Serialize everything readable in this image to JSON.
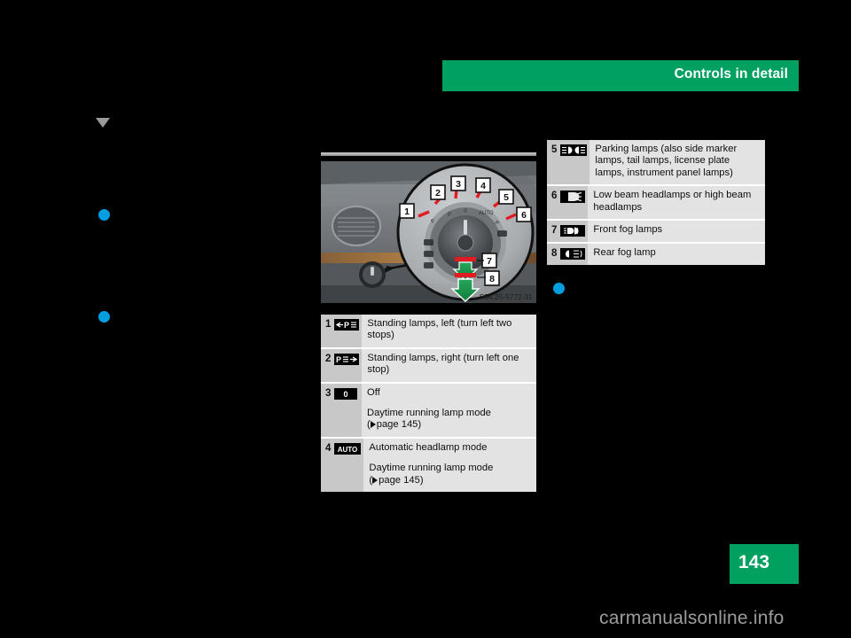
{
  "header": {
    "title": "Controls in detail",
    "accent_color": "#00a160"
  },
  "page_footer": {
    "page_number": "143",
    "watermark": "carmanualsonline.info"
  },
  "markers": {
    "triangle_icon": "triangle-down-icon",
    "bullet_color": "#009ee0"
  },
  "figure": {
    "caption": "P54.25-5772-31",
    "callouts": [
      "1",
      "2",
      "3",
      "4",
      "5",
      "6",
      "7",
      "8"
    ],
    "alt_description": "Dashboard light switch with magnified detail view"
  },
  "table_bottom": {
    "rows": [
      {
        "number": "1",
        "icon": "standing-lamps-left-icon",
        "lines": [
          "Standing lamps, left (turn left two stops)"
        ]
      },
      {
        "number": "2",
        "icon": "standing-lamps-right-icon",
        "lines": [
          "Standing lamps, right (turn left one stop)"
        ]
      },
      {
        "number": "3",
        "icon": "lights-off-icon",
        "lines": [
          "Off"
        ],
        "note": "Daytime running lamp mode",
        "pageref": "page 145"
      },
      {
        "number": "4",
        "icon": "auto-headlamp-icon",
        "lines": [
          "Automatic headlamp mode"
        ],
        "note": "Daytime running lamp mode",
        "pageref": "page 145"
      }
    ]
  },
  "table_right": {
    "rows": [
      {
        "number": "5",
        "icon": "parking-lamps-icon",
        "lines": [
          "Parking lamps (also side marker lamps, tail lamps, license plate lamps, instrument panel lamps)"
        ]
      },
      {
        "number": "6",
        "icon": "low-beam-headlamp-icon",
        "lines": [
          "Low beam headlamps or high beam headlamps"
        ]
      },
      {
        "number": "7",
        "icon": "front-fog-lamp-icon",
        "lines": [
          "Front fog lamps"
        ]
      },
      {
        "number": "8",
        "icon": "rear-fog-lamp-icon",
        "lines": [
          "Rear fog lamp"
        ]
      }
    ]
  }
}
